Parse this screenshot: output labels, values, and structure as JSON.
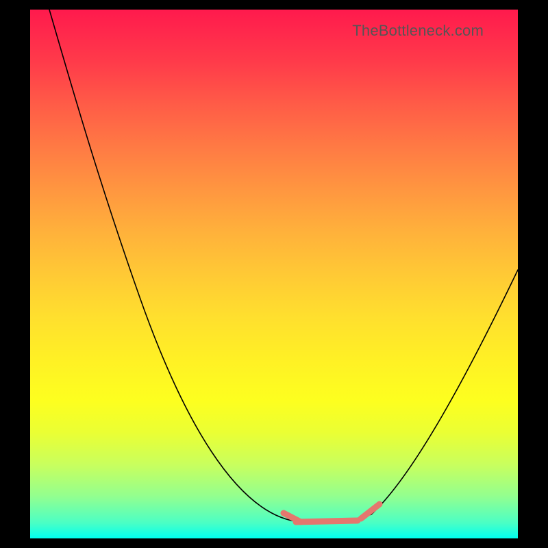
{
  "watermark": "TheBottleneck.com",
  "colors": {
    "background": "#000000",
    "gradient_top": "#ff1a4d",
    "gradient_bottom": "#00fff0",
    "curve": "#000000",
    "marker": "#e4776e",
    "watermark_text": "#555555"
  },
  "chart_data": {
    "type": "line",
    "title": "",
    "xlabel": "",
    "ylabel": "",
    "xlim": [
      0,
      100
    ],
    "ylim": [
      0,
      100
    ],
    "grid": false,
    "legend": false,
    "series": [
      {
        "name": "bottleneck-curve",
        "x": [
          4,
          10,
          16,
          22,
          28,
          34,
          40,
          46,
          52,
          56,
          60,
          64,
          68,
          72,
          78,
          84,
          90,
          96,
          100
        ],
        "values": [
          100,
          90,
          79,
          68,
          57,
          46,
          35,
          24,
          13,
          8,
          4,
          3,
          3,
          5,
          12,
          22,
          33,
          44,
          51
        ]
      }
    ],
    "annotations": [
      {
        "name": "low-bottleneck-region",
        "shape": "highlight-segment",
        "x_range": [
          52,
          72
        ],
        "y_approx": 3,
        "color": "#e4776e"
      }
    ]
  }
}
